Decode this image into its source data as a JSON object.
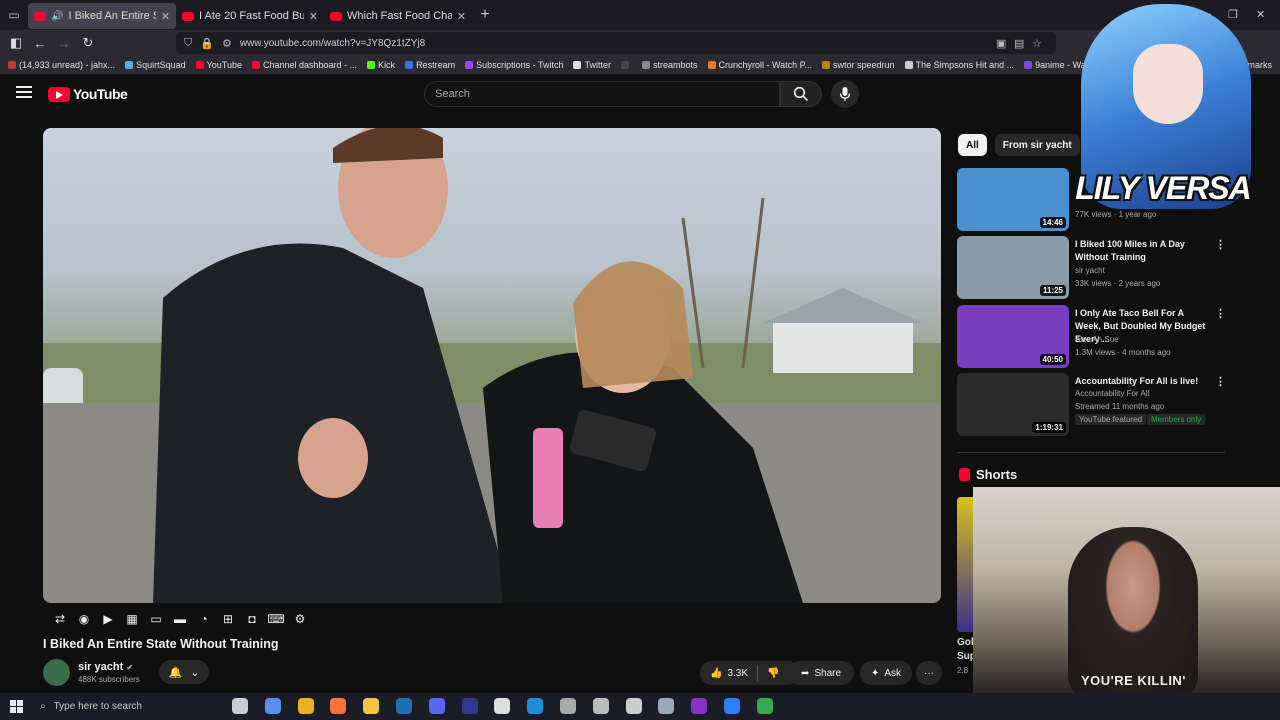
{
  "browser": {
    "tabs": [
      {
        "title": "I Biked An Entire State With",
        "active": true
      },
      {
        "title": "I Ate 20 Fast Food Burgers To S",
        "active": false
      },
      {
        "title": "Which Fast Food Chain Has The",
        "active": false
      }
    ],
    "new_tab": "+",
    "url": "www.youtube.com/watch?v=JY8Qz1tZYj8",
    "window_controls": [
      "—",
      "❐",
      "✕"
    ],
    "bookmarks": [
      {
        "label": "(14,933 unread) - jahx...",
        "color": "#c0392b"
      },
      {
        "label": "SquirtSquad",
        "color": "#5dade2"
      },
      {
        "label": "YouTube",
        "color": "#ff0033"
      },
      {
        "label": "Channel dashboard - ...",
        "color": "#ff0033"
      },
      {
        "label": "Kick",
        "color": "#53fc18"
      },
      {
        "label": "Restream",
        "color": "#3a6ff7"
      },
      {
        "label": "Subscriptions - Twitch",
        "color": "#9146ff"
      },
      {
        "label": "Twitter",
        "color": "#dddddd"
      },
      {
        "label": "",
        "color": "#444444"
      },
      {
        "label": "streambots",
        "color": "#888888"
      },
      {
        "label": "Crunchyroll - Watch P...",
        "color": "#f47521"
      },
      {
        "label": "swtor speedrun",
        "color": "#b8860b"
      },
      {
        "label": "The Simpsons Hit and ...",
        "color": "#cccccc"
      },
      {
        "label": "9anime - Watch Anim...",
        "color": "#7b4bd6"
      },
      {
        "label": "Watch Latest",
        "color": "#c0392b"
      }
    ],
    "other_bookmarks": "Other Bookmarks"
  },
  "youtube": {
    "logo": "YouTube",
    "search_placeholder": "Search",
    "video_title": "I Biked An Entire State Without Training",
    "channel": {
      "name": "sir yacht",
      "verified": "✔",
      "subscribers": "488K subscribers"
    },
    "actions": {
      "likes": "3.3K",
      "share": "Share",
      "ask": "Ask",
      "more": "···"
    },
    "player_controls": [
      "loop-icon",
      "audio-icon",
      "clip-icon",
      "chapters-icon",
      "theater-icon",
      "miniplayer-icon",
      "speed-icon",
      "add-icon",
      "screenshot-icon",
      "keyboard-icon",
      "settings-icon"
    ]
  },
  "sidebar": {
    "chips": [
      "All",
      "From sir yacht"
    ],
    "recommendations": [
      {
        "title": "",
        "channel": "",
        "meta": "77K views · 1 year ago",
        "duration": "14:46",
        "thumb_color": "#4a8fd0"
      },
      {
        "title": "I Biked 100 Miles in A Day Without Training",
        "channel": "sir yacht",
        "meta": "33K views · 2 years ago",
        "duration": "11:25",
        "thumb_color": "#8a9aa6"
      },
      {
        "title": "I Only Ate Taco Bell For A Week, But Doubled My Budget Every ...",
        "channel": "Alex Ah Sue",
        "meta": "1.3M views · 4 months ago",
        "duration": "40:50",
        "thumb_color": "#7a3fc0"
      },
      {
        "title": "Accountability For All is live!",
        "channel": "Accountability For All",
        "meta": "Streamed 11 months ago",
        "duration": "1:19:31",
        "thumb_color": "#2b2b2b"
      }
    ],
    "badges": {
      "featured": "YouTube featured",
      "members": "Members only"
    },
    "shorts_header": "Shorts",
    "short_text": [
      "Gol",
      "Sup",
      "2.8"
    ]
  },
  "overlays": {
    "vtuber_name": "LILY VERSA",
    "webcam_shirt": "YOU'RE KILLIN'"
  },
  "taskbar": {
    "search_placeholder": "Type here to search",
    "apps": [
      {
        "name": "task-view-icon",
        "color": "#cccccc"
      },
      {
        "name": "copilot-icon",
        "color": "#5b8def"
      },
      {
        "name": "chrome-icon",
        "color": "#e8b21d"
      },
      {
        "name": "firefox-icon",
        "color": "#ff7139"
      },
      {
        "name": "folder-icon",
        "color": "#f4c542"
      },
      {
        "name": "steam-icon",
        "color": "#1b6fb3"
      },
      {
        "name": "discord-icon",
        "color": "#5865f2"
      },
      {
        "name": "app-icon",
        "color": "#2f3a8f"
      },
      {
        "name": "obs-icon",
        "color": "#dddddd"
      },
      {
        "name": "refresh-app-icon",
        "color": "#1f8bd6"
      },
      {
        "name": "cloud-icon",
        "color": "#aaaaaa"
      },
      {
        "name": "disk-icon",
        "color": "#bbbbbb"
      },
      {
        "name": "compass-icon",
        "color": "#cccccc"
      },
      {
        "name": "shield-app-icon",
        "color": "#9aa8b8"
      },
      {
        "name": "next-icon",
        "color": "#8b2fc9"
      },
      {
        "name": "blue-app-icon",
        "color": "#2d7ff9"
      },
      {
        "name": "drive-icon",
        "color": "#34a853"
      }
    ]
  }
}
